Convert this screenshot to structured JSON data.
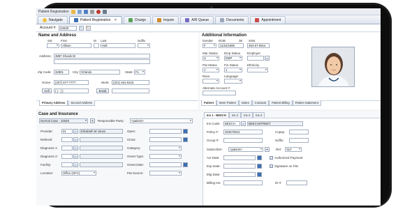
{
  "app": {
    "title": "Patient Registration"
  },
  "tabs": [
    {
      "label": "Navigate"
    },
    {
      "label": "Patient Registration"
    },
    {
      "label": "Charge"
    },
    {
      "label": "Inquire"
    },
    {
      "label": "A/R Queue"
    },
    {
      "label": "Documents"
    },
    {
      "label": "Appointment"
    }
  ],
  "account": {
    "label": "Account #:",
    "value": "10028"
  },
  "name_address": {
    "title": "Name and Address",
    "labels": {
      "sal": "Sal",
      "first": "First",
      "mi": "M",
      "last": "Last",
      "suffix": "Suffix",
      "address": "Address:",
      "zip": "Zip Code:",
      "city": "City:",
      "state": "State:",
      "home": "Home:",
      "work": "Work:",
      "cell": "Cell",
      "email": "Email"
    },
    "first": "Allison",
    "last": "Hall",
    "address": "3887 Shoals Dr",
    "zip": "32801",
    "city": "Orlando",
    "state": "FL",
    "home": "(407) 677-7777",
    "work": "(321) 461-5415",
    "cell": "(   ) -   [   ]",
    "subtabs": [
      "Primary Address",
      "Second Address"
    ]
  },
  "additional": {
    "title": "Additional Information",
    "labels": {
      "gender": "Gender",
      "dob": "DOB",
      "age": "36",
      "ssn": "SSN",
      "mar_status": "Mar Status",
      "emp_status": "Emp Status",
      "employer": "Employer",
      "pat_status": "Pat Status",
      "fin_status": "Fin Status",
      "ethnicity": "Ethnicity",
      "race": "Race",
      "language": "Language",
      "alternate": "Alternate Account #"
    },
    "gender": "F",
    "dob": "11/24/1980",
    "ssn": "394-57-8914",
    "mar_status": "S",
    "emp_status": "EMP",
    "pat_status": "1",
    "fin_status": "1",
    "subtabs": [
      "Patient",
      "More Patient",
      "Notes",
      "Contacts",
      "Patient Billing",
      "Patient Statement"
    ]
  },
  "case": {
    "title": "Case and Insurance",
    "case_value": "Normal Case - 10028",
    "responsible_label": "Responsible Party:",
    "responsible_value": "<patient>",
    "left_labels": [
      "Provider:",
      "Referral:",
      "Diagnosis 1:",
      "Diagnosis 2:",
      "Facility:",
      "Location:"
    ],
    "provider_code": "01",
    "provider_name": "Elizabeth M Jones",
    "location_value": "Office (OFC)",
    "mid_labels": [
      "Open:",
      "Close:",
      "Category:",
      "Onset Type:",
      "Onset Date:",
      "Pat Source:"
    ],
    "ins_tabs": [
      "Ins 1 - BEECH",
      "Ins 2",
      "Ins 3",
      "Ins 4"
    ],
    "ins_labels": {
      "ins_code": "Ins Code:",
      "policy": "Policy #:",
      "group": "Group #:",
      "copay": "Copay:",
      "suffix": "Suffix:",
      "subscriber": "Subscriber:",
      "rel": "Rel:",
      "act_date": "Act Date:",
      "exp_date": "Exp Date:",
      "elig_date": "Elig Date:",
      "billing_ins": "Billing Ins:",
      "id": "ID #:"
    },
    "ins_code": "BEECH",
    "ins_name": "BEECHSTREET",
    "policy": "394578914",
    "policy2": "123",
    "subscriber": "<patient>",
    "rel": "SLF",
    "checks": [
      "Authorized Payment",
      "Signature on File"
    ]
  },
  "colors": {
    "accent": "#3c6fb0",
    "frame": "#1b1b1b"
  }
}
